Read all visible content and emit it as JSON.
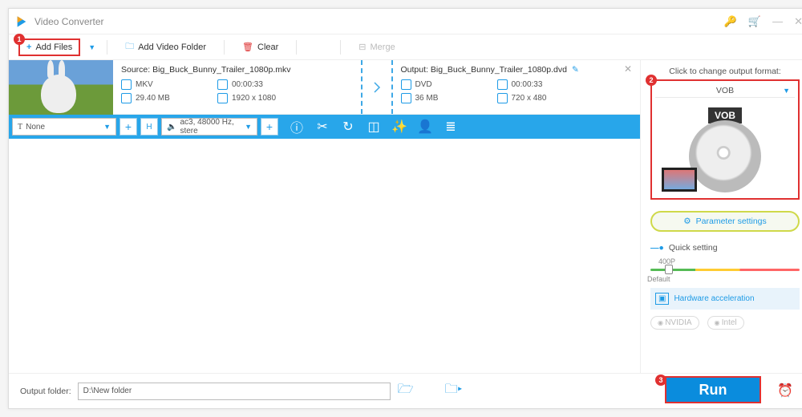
{
  "app": {
    "title": "Video Converter"
  },
  "titlebar_icons": {
    "upgrade": "⚿",
    "cart": "🛒",
    "min": "—",
    "close": "✕"
  },
  "toolbar": {
    "add_files": "Add Files",
    "add_folder": "Add Video Folder",
    "clear": "Clear",
    "merge": "Merge"
  },
  "file": {
    "source_label": "Source:",
    "source_name": "Big_Buck_Bunny_Trailer_1080p.mkv",
    "src": {
      "format": "MKV",
      "duration": "00:00:33",
      "size": "29.40 MB",
      "res": "1920 x 1080"
    },
    "output_label": "Output:",
    "output_name": "Big_Buck_Bunny_Trailer_1080p.dvd",
    "out": {
      "format": "DVD",
      "duration": "00:00:33",
      "size": "36 MB",
      "res": "720 x 480"
    }
  },
  "tracks": {
    "text_track": "None",
    "text_prefix": "T",
    "audio_track": "ac3, 48000 Hz, stere",
    "audio_icon": "🔈"
  },
  "right": {
    "hint": "Click to change output format:",
    "format_name": "VOB",
    "format_badge": "VOB",
    "param_label": "Parameter settings",
    "quick_label": "Quick setting",
    "slider_val": "400P",
    "slider_default": "Default",
    "hw_label": "Hardware acceleration",
    "gpu1": "NVIDIA",
    "gpu2": "Intel"
  },
  "bottom": {
    "out_label": "Output folder:",
    "out_path": "D:\\New folder",
    "run": "Run"
  },
  "badges": {
    "b1": "1",
    "b2": "2",
    "b3": "3"
  }
}
